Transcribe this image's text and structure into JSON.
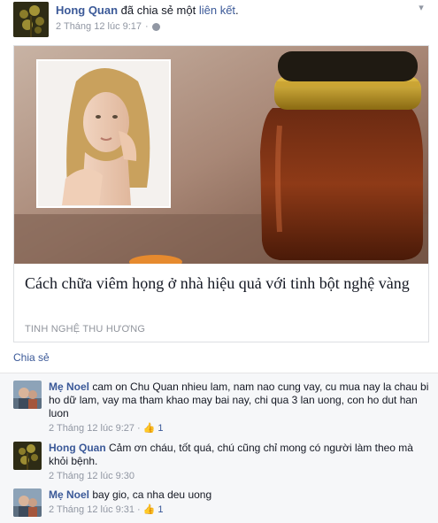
{
  "post": {
    "author": "Hong Quan",
    "action_text": "đã chia sẻ một",
    "action_link": "liên kết",
    "action_suffix": ".",
    "timestamp": "2 Tháng 12 lúc 9:17",
    "separator": "·"
  },
  "link_preview": {
    "title": "Cách chữa viêm họng ở nhà hiệu quả với tinh bột nghệ vàng",
    "domain": "TINH NGHỆ THU HƯƠNG"
  },
  "actions": {
    "share_label": "Chia sẻ"
  },
  "comments": [
    {
      "author": "Mẹ Noel",
      "text": "cam on Chu Quan nhieu lam, nam nao cung vay, cu mua nay la chau bi ho dữ lam, vay ma tham khao may bai nay, chi qua 3 lan uong, con ho dut han luon",
      "timestamp": "2 Tháng 12 lúc 9:27",
      "likes": "1"
    },
    {
      "author": "Hong Quan",
      "text": "Cảm ơn cháu, tốt quá, chú cũng chỉ mong có người làm theo mà khỏi bệnh.",
      "timestamp": "2 Tháng 12 lúc 9:30",
      "likes": ""
    },
    {
      "author": "Mẹ Noel",
      "text": "bay gio, ca nha deu uong",
      "timestamp": "2 Tháng 12 lúc 9:31",
      "likes": "1"
    }
  ],
  "colors": {
    "link_blue": "#3b5998",
    "meta_gray": "#9197a3",
    "comment_bg": "#f6f7f9"
  }
}
